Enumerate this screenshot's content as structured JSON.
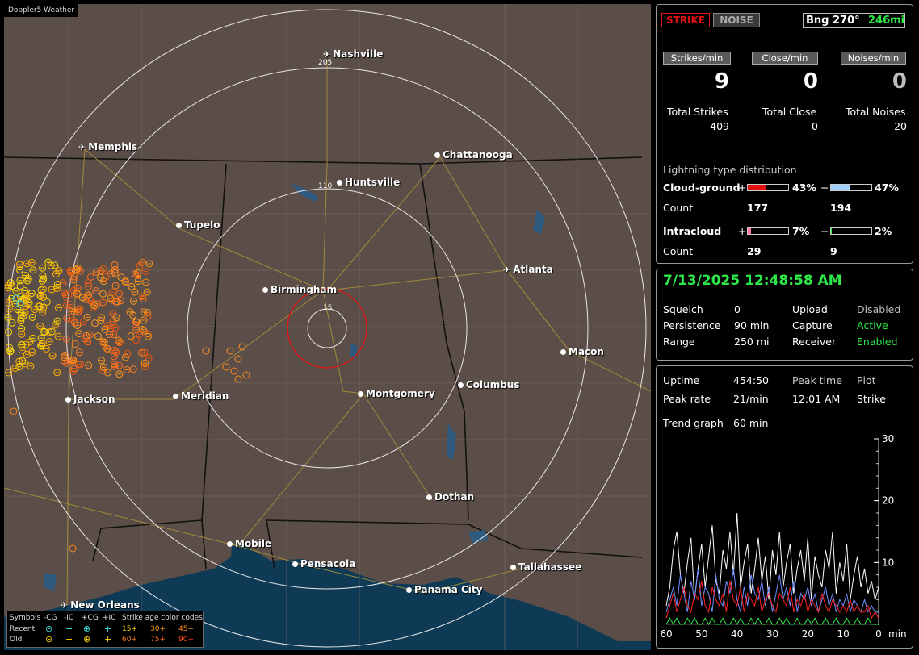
{
  "brand": "Doppler5 Weather",
  "colors": {
    "map_bg": "#5b4d48",
    "water": "#0e3a55",
    "accent_green": "#2ee84a",
    "red": "#e01010",
    "blue": "#9fd0ff",
    "pink": "#ff6fa8"
  },
  "map": {
    "cities": [
      {
        "name": "Nashville",
        "icon": "plane-icon"
      },
      {
        "name": "Memphis",
        "icon": "plane-icon"
      },
      {
        "name": "Chattanooga",
        "icon": "dot"
      },
      {
        "name": "Huntsville",
        "icon": "dot"
      },
      {
        "name": "Tupelo",
        "icon": "dot"
      },
      {
        "name": "Atlanta",
        "icon": "plane-icon"
      },
      {
        "name": "Birmingham",
        "icon": "dot"
      },
      {
        "name": "Macon",
        "icon": "dot"
      },
      {
        "name": "Jackson",
        "icon": "dot"
      },
      {
        "name": "Meridian",
        "icon": "dot"
      },
      {
        "name": "Montgomery",
        "icon": "dot"
      },
      {
        "name": "Columbus",
        "icon": "dot"
      },
      {
        "name": "Dothan",
        "icon": "dot"
      },
      {
        "name": "Mobile",
        "icon": "dot"
      },
      {
        "name": "Pensacola",
        "icon": "dot"
      },
      {
        "name": "Tallahassee",
        "icon": "dot"
      },
      {
        "name": "Panama City",
        "icon": "dot"
      },
      {
        "name": "New Orleans",
        "icon": "plane-icon"
      }
    ],
    "ring_labels": [
      "205",
      "110",
      "15"
    ],
    "legend": {
      "header_symbols": "Symbols",
      "cols": [
        "-CG",
        "-IC",
        "+CG",
        "+IC"
      ],
      "age_title": "Strike age color codes",
      "recent": "Recent",
      "old": "Old",
      "recent_ages": [
        "15+",
        "30+",
        "45+"
      ],
      "old_ages": [
        "60+",
        "75+",
        "90+"
      ]
    }
  },
  "status": {
    "strike_label": "STRIKE",
    "noise_label": "NOISE",
    "bearing": "Bng 270°",
    "distance": "246mi",
    "rate_buttons": [
      "Strikes/min",
      "Close/min",
      "Noises/min"
    ],
    "rates": [
      "9",
      "0",
      "0"
    ],
    "total_labels": [
      "Total Strikes",
      "Total Close",
      "Total Noises"
    ],
    "totals": [
      "409",
      "0",
      "20"
    ],
    "dist_title": "Lightning type distribution",
    "cg_label": "Cloud-ground",
    "ic_label": "Intracloud",
    "count_label": "Count",
    "plus": "+",
    "minus": "−",
    "cg_plus_pct": "43%",
    "cg_minus_pct": "47%",
    "ic_plus_pct": "7%",
    "ic_minus_pct": "2%",
    "cg_plus_frac": 0.43,
    "cg_minus_frac": 0.47,
    "ic_plus_frac": 0.07,
    "ic_minus_frac": 0.02,
    "cg_plus_count": "177",
    "cg_minus_count": "194",
    "ic_plus_count": "29",
    "ic_minus_count": "9"
  },
  "settings": {
    "datetime": "7/13/2025 12:48:58 AM",
    "rows": [
      {
        "k": "Squelch",
        "v": "0",
        "k2": "Upload",
        "v2": "Disabled"
      },
      {
        "k": "Persistence",
        "v": "90 min",
        "k2": "Capture",
        "v2": "Active"
      },
      {
        "k": "Range",
        "v": "250 mi",
        "k2": "Receiver",
        "v2": "Enabled"
      }
    ]
  },
  "stats": {
    "uptime_label": "Uptime",
    "uptime": "454:50",
    "peak_time_label": "Peak time",
    "plot_label": "Plot",
    "peak_rate_label": "Peak rate",
    "peak_rate": "21/min",
    "peak_time": "12:01 AM",
    "plot_value": "Strike",
    "trend_label": "Trend graph",
    "trend_value": "60 min"
  },
  "chart_data": {
    "type": "line",
    "x_ticks": [
      "60",
      "50",
      "40",
      "30",
      "20",
      "10",
      "0"
    ],
    "x_unit": "min",
    "y_ticks": [
      "30",
      "20",
      "10"
    ],
    "ylim": [
      0,
      30
    ],
    "xlim": [
      60,
      0
    ],
    "series": [
      {
        "color": "#ffffff",
        "values": [
          3,
          6,
          12,
          15,
          8,
          5,
          10,
          14,
          4,
          9,
          13,
          6,
          11,
          16,
          7,
          5,
          12,
          9,
          15,
          8,
          18,
          6,
          10,
          13,
          5,
          9,
          14,
          7,
          11,
          4,
          12,
          8,
          15,
          6,
          10,
          13,
          5,
          9,
          12,
          7,
          14,
          4,
          11,
          8,
          6,
          12,
          9,
          15,
          5,
          10,
          7,
          13,
          4,
          8,
          11,
          6,
          9,
          5,
          7,
          4,
          6
        ]
      },
      {
        "color": "#6f8fff",
        "values": [
          2,
          4,
          6,
          3,
          8,
          5,
          2,
          7,
          4,
          9,
          3,
          6,
          5,
          2,
          8,
          4,
          3,
          7,
          5,
          9,
          4,
          2,
          6,
          3,
          8,
          5,
          4,
          7,
          3,
          6,
          2,
          5,
          8,
          4,
          6,
          3,
          7,
          2,
          5,
          4,
          6,
          3,
          5,
          2,
          4,
          6,
          3,
          5,
          2,
          4,
          3,
          5,
          2,
          4,
          3,
          2,
          4,
          2,
          3,
          2,
          2
        ]
      },
      {
        "color": "#ff2020",
        "values": [
          1,
          3,
          5,
          2,
          4,
          6,
          3,
          2,
          5,
          4,
          7,
          3,
          2,
          6,
          4,
          3,
          5,
          2,
          7,
          4,
          3,
          6,
          2,
          5,
          4,
          3,
          6,
          2,
          4,
          5,
          3,
          2,
          5,
          4,
          3,
          6,
          2,
          4,
          3,
          5,
          2,
          4,
          3,
          2,
          5,
          3,
          2,
          4,
          3,
          2,
          3,
          2,
          4,
          2,
          3,
          2,
          2,
          3,
          1,
          2,
          1
        ]
      },
      {
        "color": "#2ee84a",
        "values": [
          0,
          1,
          0,
          1,
          0,
          0,
          1,
          0,
          1,
          0,
          0,
          1,
          0,
          1,
          0,
          0,
          1,
          0,
          0,
          1,
          0,
          1,
          0,
          0,
          1,
          0,
          1,
          0,
          0,
          1,
          0,
          0,
          1,
          0,
          1,
          0,
          0,
          1,
          0,
          0,
          1,
          0,
          1,
          0,
          0,
          1,
          0,
          0,
          1,
          0,
          0,
          1,
          0,
          0,
          1,
          0,
          0,
          1,
          0,
          0,
          0
        ]
      }
    ]
  }
}
